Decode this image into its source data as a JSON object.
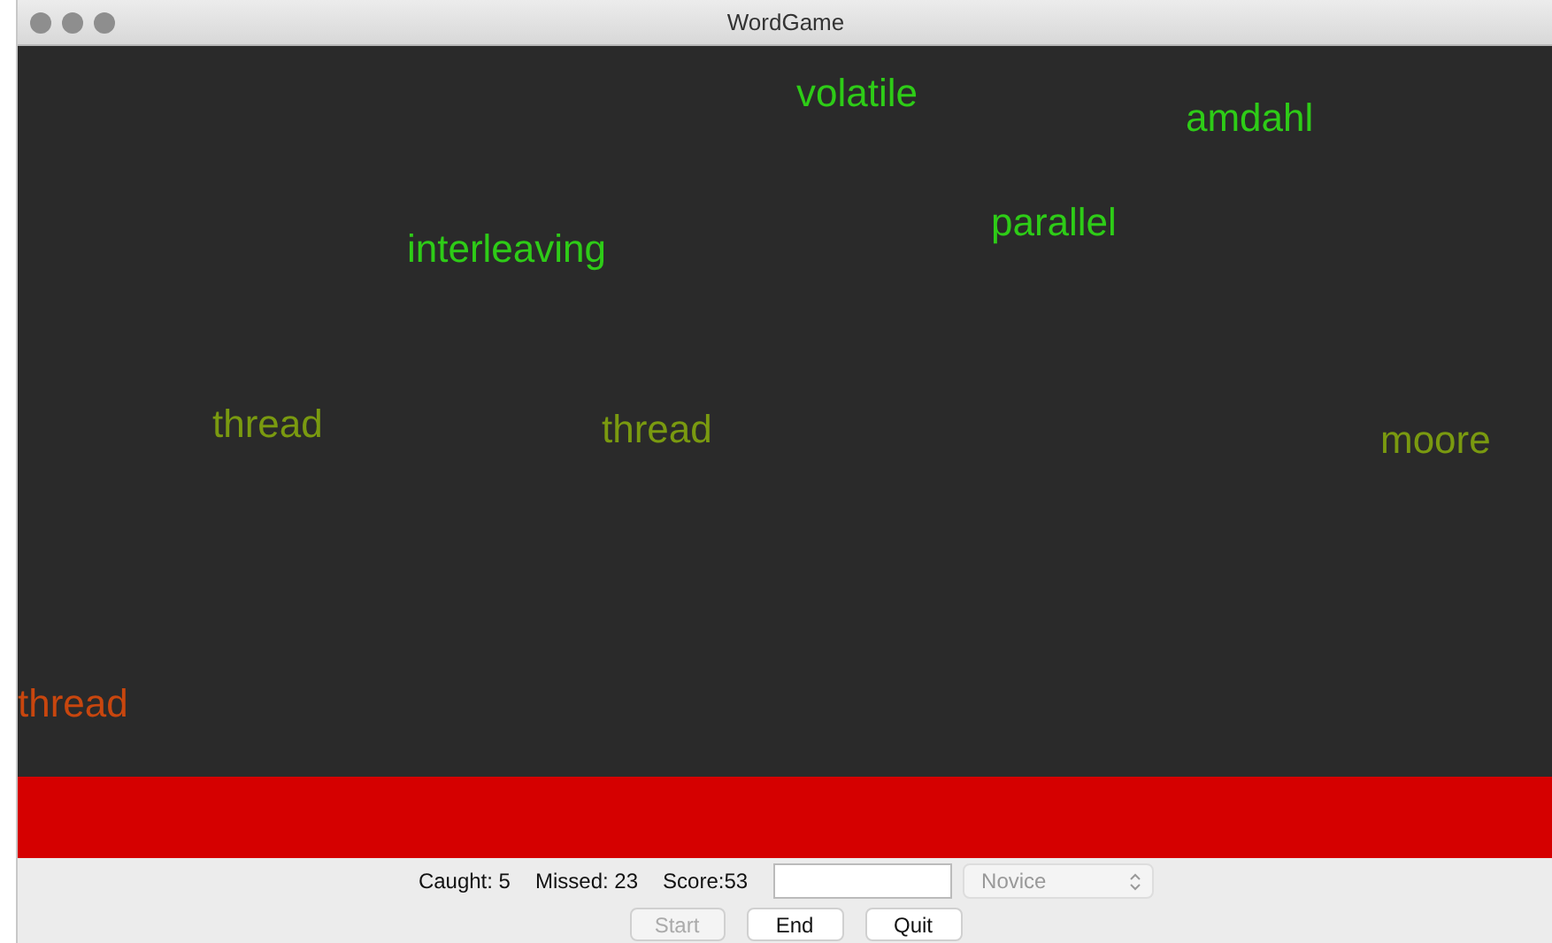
{
  "window": {
    "title": "WordGame"
  },
  "words": [
    {
      "text": "volatile",
      "color": "#2ecc17"
    },
    {
      "text": "amdahl",
      "color": "#2ecc17"
    },
    {
      "text": "parallel",
      "color": "#2ecc17"
    },
    {
      "text": "interleaving",
      "color": "#2ecc17"
    },
    {
      "text": "thread",
      "color": "#7a9a10"
    },
    {
      "text": "thread",
      "color": "#7a9a10"
    },
    {
      "text": "moore",
      "color": "#7a9a10"
    },
    {
      "text": "thread",
      "color": "#c8460e"
    }
  ],
  "stats": [
    "Caught: 5",
    "Missed: 23",
    "Score:53"
  ],
  "level": {
    "value": "Novice",
    "disabled": true
  },
  "buttons": [
    {
      "label": "Start",
      "disabled": true
    },
    {
      "label": "End",
      "disabled": false
    },
    {
      "label": "Quit",
      "disabled": false
    }
  ]
}
